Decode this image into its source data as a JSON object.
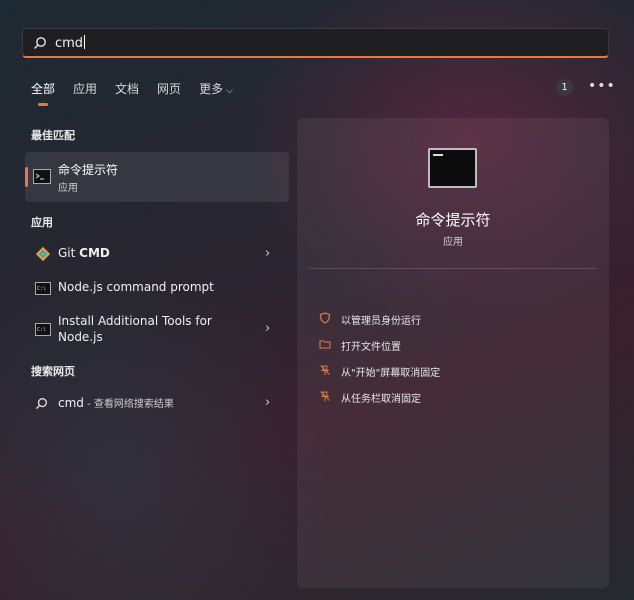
{
  "search": {
    "value": "cmd"
  },
  "tabs": [
    {
      "label": "全部",
      "active": true
    },
    {
      "label": "应用"
    },
    {
      "label": "文档"
    },
    {
      "label": "网页"
    },
    {
      "label": "更多"
    }
  ],
  "badge_count": "1",
  "sections": {
    "best_match": "最佳匹配",
    "apps": "应用",
    "web": "搜索网页"
  },
  "best_match": {
    "title": "命令提示符",
    "subtitle": "应用"
  },
  "apps": [
    {
      "name_prefix": "Git ",
      "name_bold": "CMD",
      "icon": "git-icon"
    },
    {
      "name": "Node.js command prompt",
      "icon": "console-icon"
    },
    {
      "name_line1": "Install Additional Tools for",
      "name_line2": "Node.js",
      "icon": "console-icon"
    }
  ],
  "web": {
    "query": "cmd",
    "hint": " - 查看网络搜索结果"
  },
  "panel": {
    "title": "命令提示符",
    "subtitle": "应用",
    "actions": [
      {
        "label": "以管理员身份运行",
        "icon": "shield-icon"
      },
      {
        "label": "打开文件位置",
        "icon": "folder-icon"
      },
      {
        "label": "从\"开始\"屏幕取消固定",
        "icon": "unpin-icon"
      },
      {
        "label": "从任务栏取消固定",
        "icon": "unpin-icon"
      }
    ]
  },
  "colors": {
    "accent": "#e07a4a"
  }
}
